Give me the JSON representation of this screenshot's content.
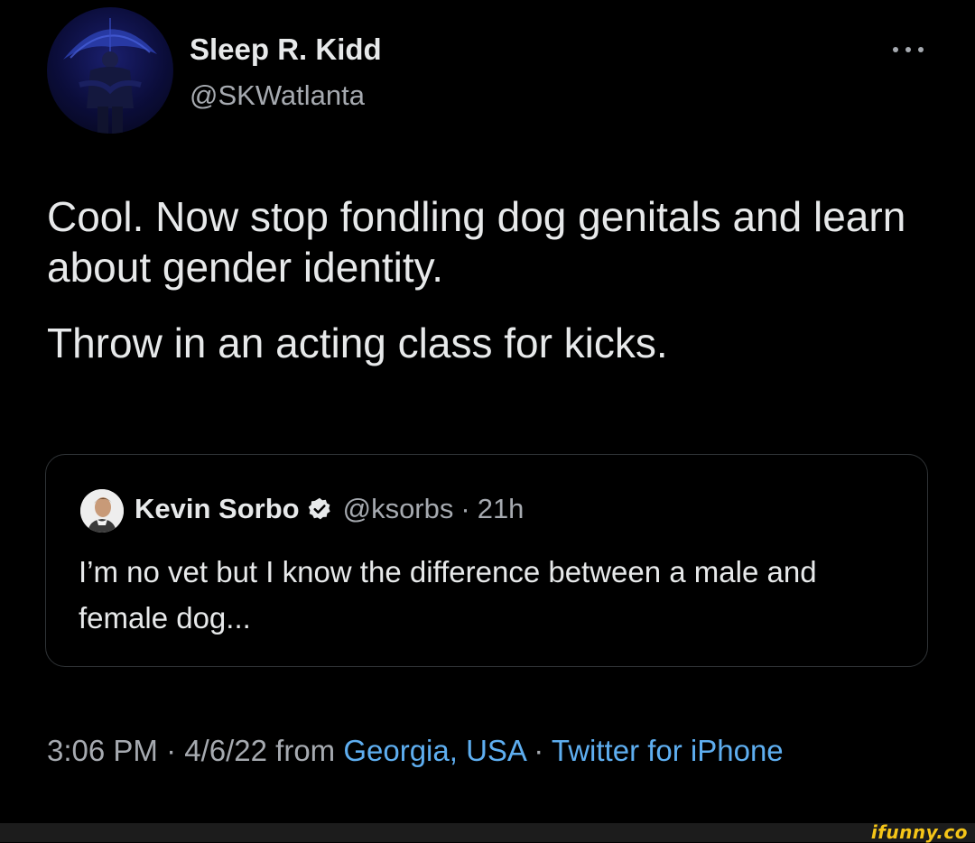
{
  "tweet": {
    "author": {
      "display_name": "Sleep R. Kidd",
      "handle": "@SKWatlanta",
      "avatar_icon": "profile-photo-person-umbrella"
    },
    "more_icon": "ellipsis-icon",
    "paragraphs": [
      "Cool.  Now stop fondling dog genitals and learn about gender identity.",
      "Throw in an acting class for kicks."
    ],
    "quote": {
      "display_name": "Kevin Sorbo",
      "verified_icon": "verified-badge-icon",
      "handle": "@ksorbs",
      "separator": "·",
      "time": "21h",
      "text": "I’m no vet but I know the difference between a male and female dog..."
    },
    "meta": {
      "time": "3:06 PM",
      "sep1": "·",
      "date": "4/6/22",
      "from_label": "from",
      "location": "Georgia, USA",
      "sep2": "·",
      "source": "Twitter for iPhone"
    }
  },
  "watermark": "ifunny.co",
  "colors": {
    "background": "#000000",
    "text": "#e7e9ea",
    "secondary_text": "#a6aab0",
    "link": "#5eaef0",
    "border": "#2f3336",
    "watermark": "#f5c518"
  }
}
